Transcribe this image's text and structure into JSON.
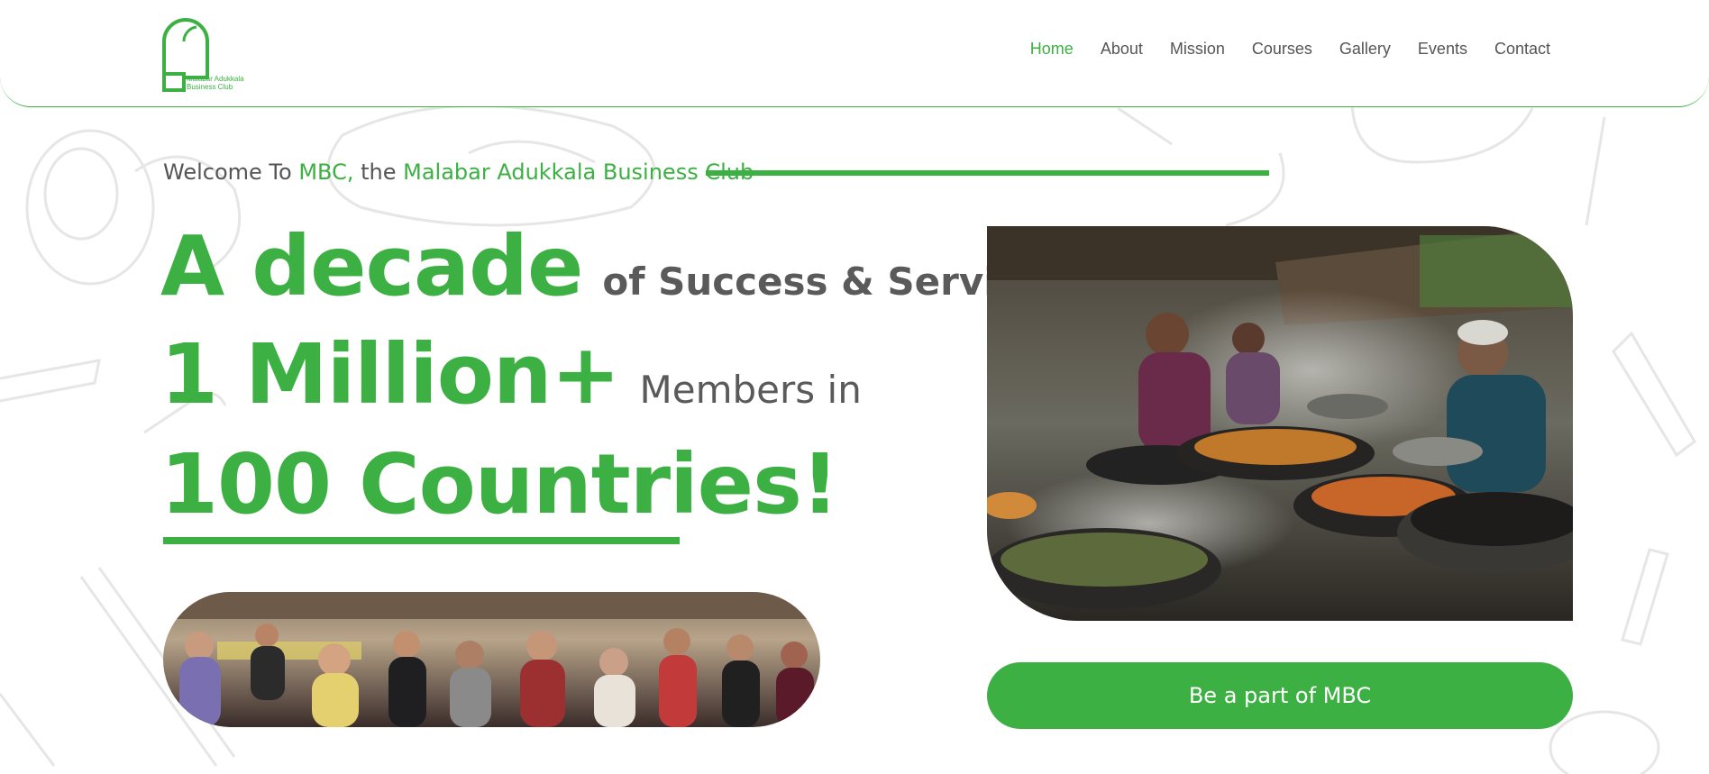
{
  "brand": {
    "name_line1": "Malabar Adukkala",
    "name_line2": "Business Club",
    "color": "#3cb043"
  },
  "nav": {
    "items": [
      {
        "label": "Home",
        "active": true
      },
      {
        "label": "About"
      },
      {
        "label": "Mission"
      },
      {
        "label": "Courses"
      },
      {
        "label": "Gallery"
      },
      {
        "label": "Events"
      },
      {
        "label": "Contact"
      }
    ]
  },
  "hero": {
    "welcome_prefix": "Welcome To ",
    "welcome_mbc": "MBC,",
    "welcome_the": " the ",
    "welcome_club": "Malabar Adukkala Business Club",
    "line1_big": "A decade",
    "line1_small": "of Success & Service to",
    "line2_big": "1 Million+",
    "line2_small": "Members in",
    "line3_big": "100 Countries!",
    "cta_label": "Be a part of MBC"
  },
  "images": {
    "crowd": "group-photo",
    "cooking": "cooking-photo"
  }
}
